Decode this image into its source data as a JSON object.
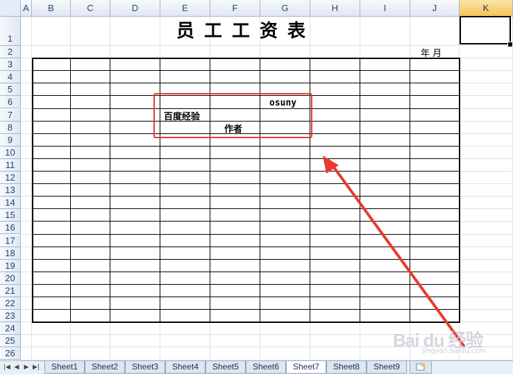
{
  "columns": [
    "A",
    "B",
    "C",
    "D",
    "E",
    "F",
    "G",
    "H",
    "I",
    "J",
    "K"
  ],
  "active_column": "K",
  "rows": [
    "1",
    "2",
    "3",
    "4",
    "5",
    "6",
    "7",
    "8",
    "9",
    "10",
    "11",
    "12",
    "13",
    "14",
    "15",
    "16",
    "17",
    "18",
    "19",
    "20",
    "21",
    "22",
    "23",
    "24",
    "25",
    "26"
  ],
  "sheet": {
    "title": "员工工资表",
    "year_month_label": "年     月",
    "cells": {
      "g6": "osuny",
      "e7": "百度经验",
      "f8": "作者"
    }
  },
  "tabs": [
    "Sheet1",
    "Sheet2",
    "Sheet3",
    "Sheet4",
    "Sheet5",
    "Sheet6",
    "Sheet7",
    "Sheet8",
    "Sheet9"
  ],
  "active_tab": "Sheet7",
  "colors": {
    "annotation_red": "#e83a2f",
    "header_blue": "#27436b"
  },
  "icons": {
    "nav": [
      "first-sheet-icon",
      "prev-sheet-icon",
      "next-sheet-icon",
      "last-sheet-icon"
    ],
    "insert_sheet": "insert-sheet-icon",
    "annotation_arrow": "red-arrow-icon"
  },
  "watermark": {
    "text": "Bai du 经验",
    "sub": "jingyan.baidu.com"
  }
}
